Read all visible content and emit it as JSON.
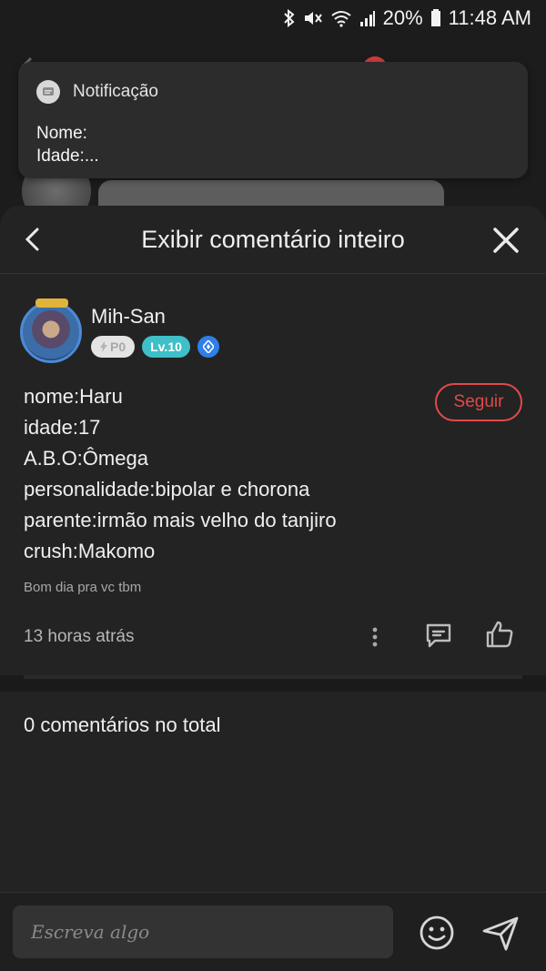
{
  "status_bar": {
    "battery": "20%",
    "time": "11:48 AM",
    "icons": [
      "bluetooth-icon",
      "mute-icon",
      "wifi-icon",
      "signal-icon",
      "battery-icon"
    ]
  },
  "notification": {
    "app_label": "Notificação",
    "line1": "Nome:",
    "line2": "Idade:..."
  },
  "sheet": {
    "title": "Exibir comentário inteiro"
  },
  "comment": {
    "author": "Mih-San",
    "badge_p0": "P0",
    "badge_level": "Lv.10",
    "follow_label": "Seguir",
    "lines": [
      "nome:Haru",
      "idade:17",
      "A.B.O:Ômega",
      "personalidade:bipolar e chorona",
      "parente:irmão mais velho do tanjiro",
      "crush:Makomo"
    ],
    "reply_note": "Bom dia pra vc tbm",
    "timestamp": "13 horas atrás"
  },
  "total_comments": "0 comentários no total",
  "input": {
    "placeholder": "Escreva algo"
  },
  "colors": {
    "accent_red": "#e04a4a",
    "level_teal": "#3fbfc7",
    "diamond_blue": "#2f7fe8",
    "background": "#232323"
  }
}
